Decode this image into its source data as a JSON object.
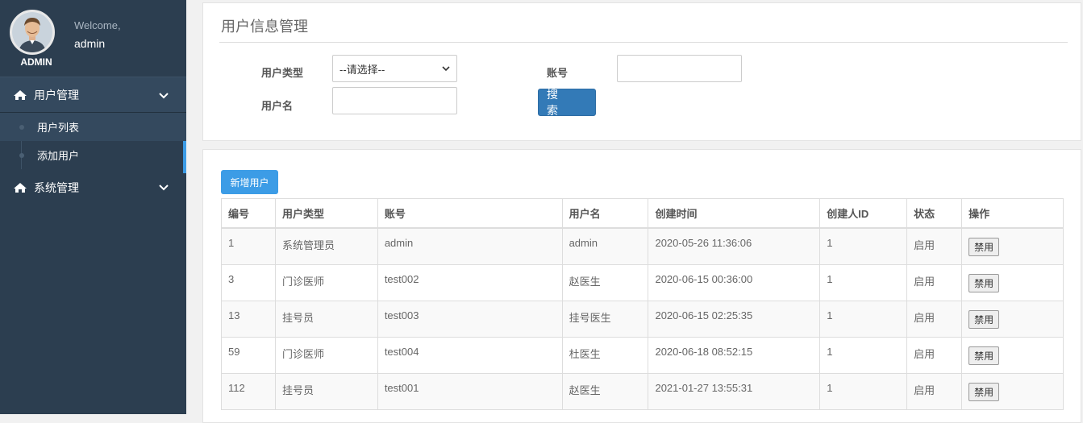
{
  "sidebar": {
    "welcome": "Welcome,",
    "username": "admin",
    "role_label": "ADMIN",
    "menu": [
      {
        "label": "用户管理",
        "icon": "home-icon",
        "expanded": true,
        "children": [
          "用户列表",
          "添加用户"
        ]
      },
      {
        "label": "系统管理",
        "icon": "home-icon",
        "expanded": false
      }
    ]
  },
  "search_panel": {
    "title": "用户信息管理",
    "user_type_label": "用户类型",
    "user_type_value": "--请选择--",
    "account_label": "账号",
    "account_value": "",
    "username_label": "用户名",
    "username_value": "",
    "search_button": "搜 索"
  },
  "table_panel": {
    "add_button": "新增用户",
    "columns": [
      "编号",
      "用户类型",
      "账号",
      "用户名",
      "创建时间",
      "创建人ID",
      "状态",
      "操作"
    ],
    "rows": [
      [
        "1",
        "系统管理员",
        "admin",
        "admin",
        "2020-05-26 11:36:06",
        "1",
        "启用",
        "禁用"
      ],
      [
        "3",
        "门诊医师",
        "test002",
        "赵医生",
        "2020-06-15 00:36:00",
        "1",
        "启用",
        "禁用"
      ],
      [
        "13",
        "挂号员",
        "test003",
        "挂号医生",
        "2020-06-15 02:25:35",
        "1",
        "启用",
        "禁用"
      ],
      [
        "59",
        "门诊医师",
        "test004",
        "杜医生",
        "2020-06-18 08:52:15",
        "1",
        "启用",
        "禁用"
      ],
      [
        "112",
        "挂号员",
        "test001",
        "赵医生",
        "2021-01-27 13:55:31",
        "1",
        "启用",
        "禁用"
      ]
    ]
  },
  "colors": {
    "sidebar_bg": "#2c3e50",
    "accent": "#3c9ce6",
    "search_button": "#337ab7"
  }
}
